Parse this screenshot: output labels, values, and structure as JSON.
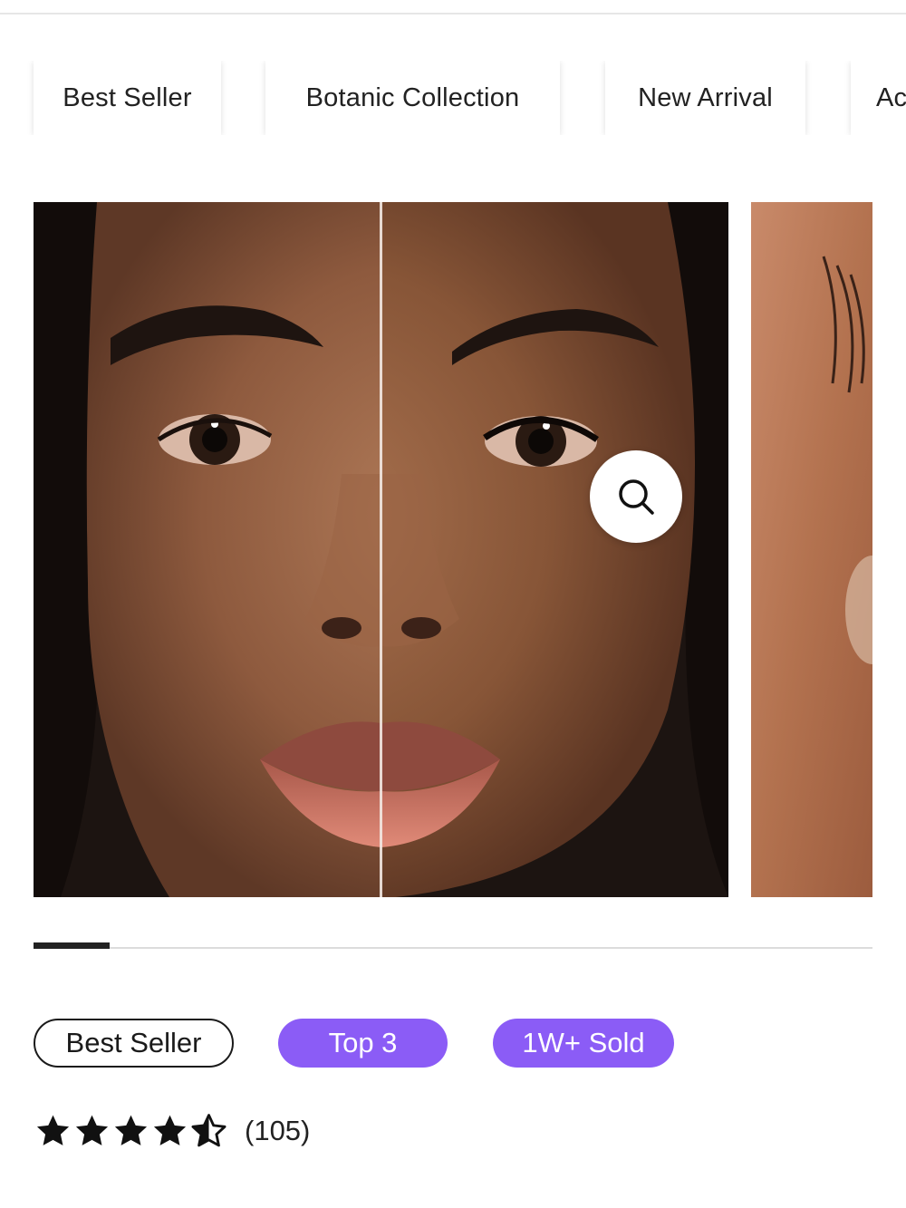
{
  "category_chips": [
    {
      "label": "Best Seller"
    },
    {
      "label": "Botanic Collection"
    },
    {
      "label": "New Arrival"
    },
    {
      "label": "Ac"
    }
  ],
  "gallery": {
    "slides": [
      {
        "description": "before-after-face-comparison"
      },
      {
        "description": "close-up-skin"
      }
    ],
    "zoom_icon": "search-icon",
    "progress": 0.09
  },
  "badges": [
    {
      "label": "Best Seller",
      "style": "outline"
    },
    {
      "label": "Top 3",
      "style": "filled"
    },
    {
      "label": "1W+ Sold",
      "style": "filled"
    }
  ],
  "colors": {
    "accent": "#8b5cf6",
    "text": "#1a1a1a"
  },
  "rating": {
    "value": 4.5,
    "max": 5,
    "count_text": "(105)"
  }
}
